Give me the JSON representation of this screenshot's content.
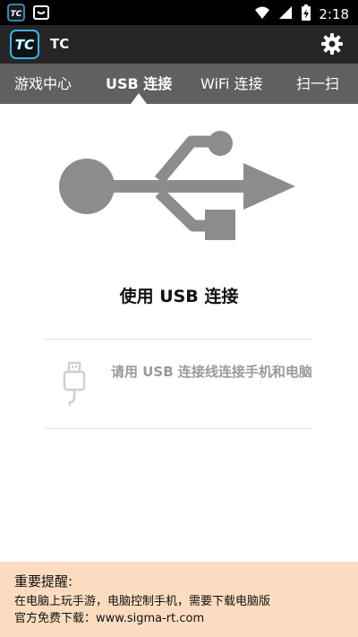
{
  "status_bar": {
    "time": "2:18",
    "notification_icons": [
      "tc-app-icon",
      "android-inbox-icon"
    ],
    "system_icons": [
      "wifi-icon",
      "signal-icon",
      "battery-charging-icon"
    ]
  },
  "app_bar": {
    "title": "TC",
    "logo_text": "TC"
  },
  "tabs": [
    {
      "label": "游戏中心",
      "active": false
    },
    {
      "label": "USB 连接",
      "active": true
    },
    {
      "label": "WiFi 连接",
      "active": false
    },
    {
      "label": "扫一扫",
      "active": false
    }
  ],
  "main": {
    "heading": "使用 USB 连接",
    "instruction": "请用 USB 连接线连接手机和电脑"
  },
  "notice": {
    "title": "重要提醒:",
    "line1": "在电脑上玩手游，电脑控制手机，需要下载电脑版",
    "line2": "官方免费下载：www.sigma-rt.com"
  },
  "colors": {
    "status_bar": "#000000",
    "app_bar": "#262626",
    "tab_bar": "#606060",
    "usb_symbol": "#8c8c8c",
    "notice_bg": "#fbdcc0",
    "logo_accent": "#33b5e5"
  }
}
